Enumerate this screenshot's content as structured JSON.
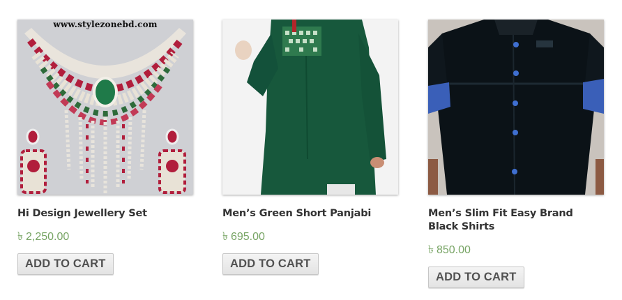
{
  "products": [
    {
      "image_alt": "jewellery-set-photo",
      "image_watermark": "www.stylezonebd.com",
      "title": "Hi Design Jewellery Set",
      "currency": "৳",
      "price": "2,250.00",
      "button_label": "ADD TO CART"
    },
    {
      "image_alt": "green-panjabi-photo",
      "title": "Men’s Green Short Panjabi",
      "currency": "৳",
      "price": "695.00",
      "button_label": "ADD TO CART"
    },
    {
      "image_alt": "black-shirt-photo",
      "title": "Men’s Slim Fit Easy Brand Black Shirts",
      "currency": "৳",
      "price": "850.00",
      "button_label": "ADD TO CART"
    }
  ],
  "colors": {
    "price": "#77a464",
    "title": "#333333",
    "button_text": "#515151"
  }
}
